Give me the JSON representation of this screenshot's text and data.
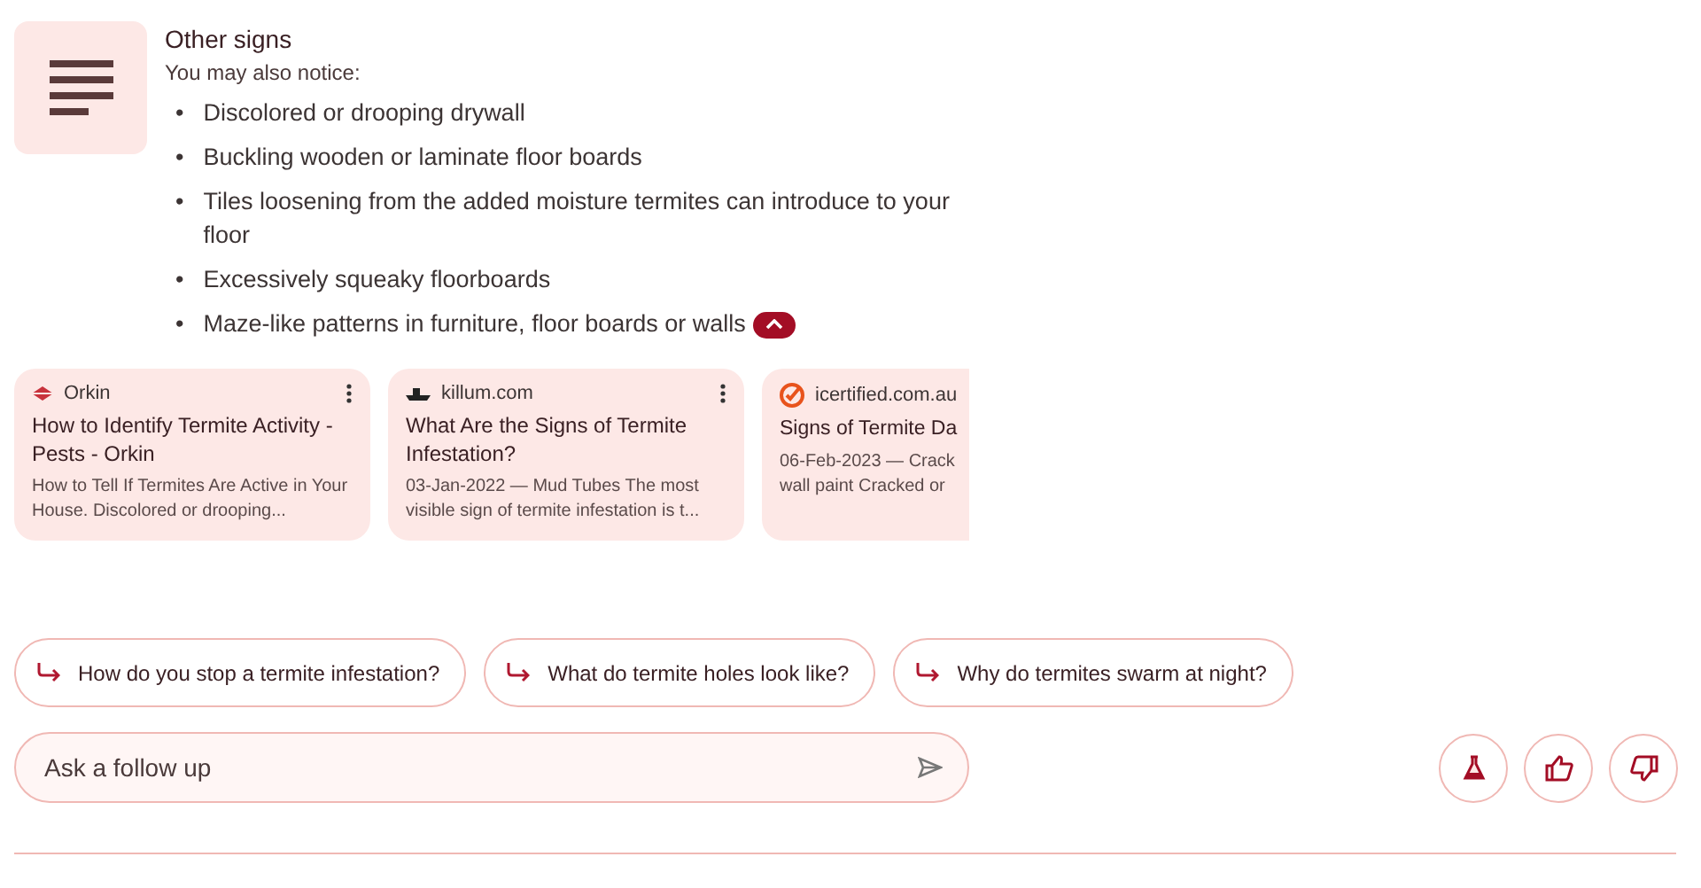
{
  "section": {
    "title": "Other signs",
    "subtitle": "You may also notice:",
    "items": [
      {
        "bullet": "•",
        "text": "Discolored or drooping drywall"
      },
      {
        "bullet": "•",
        "text": "Buckling wooden or laminate floor boards"
      },
      {
        "bullet": "•",
        "text": "Tiles loosening from the added moisture termites can introduce to your floor"
      },
      {
        "bullet": "•",
        "text": "Excessively squeaky floorboards"
      },
      {
        "bullet": "•",
        "text": "Maze-like patterns in furniture, floor boards or walls"
      }
    ],
    "expanded": true
  },
  "sources": [
    {
      "kind": "diamond",
      "site": "Orkin",
      "title": "How to Identify Termite Activity - Pests - Orkin",
      "snippet": "How to Tell If Termites Are Active in Your House. Discolored or drooping...",
      "menu": true
    },
    {
      "kind": "ship",
      "site": "killum.com",
      "title": "What Are the Signs of Termite Infestation?",
      "snippet": "03-Jan-2022 — Mud Tubes The most visible sign of termite infestation is t...",
      "menu": true
    },
    {
      "kind": "check",
      "site": "icertified.com.au",
      "title": "Signs of Termite Da",
      "snippet": "06-Feb-2023 — Crack wall paint Cracked or",
      "menu": false
    }
  ],
  "suggestions": [
    "How do you stop a termite infestation?",
    "What do termite holes look like?",
    "Why do termites swarm at night?"
  ],
  "followup": {
    "placeholder": "Ask a follow up"
  }
}
